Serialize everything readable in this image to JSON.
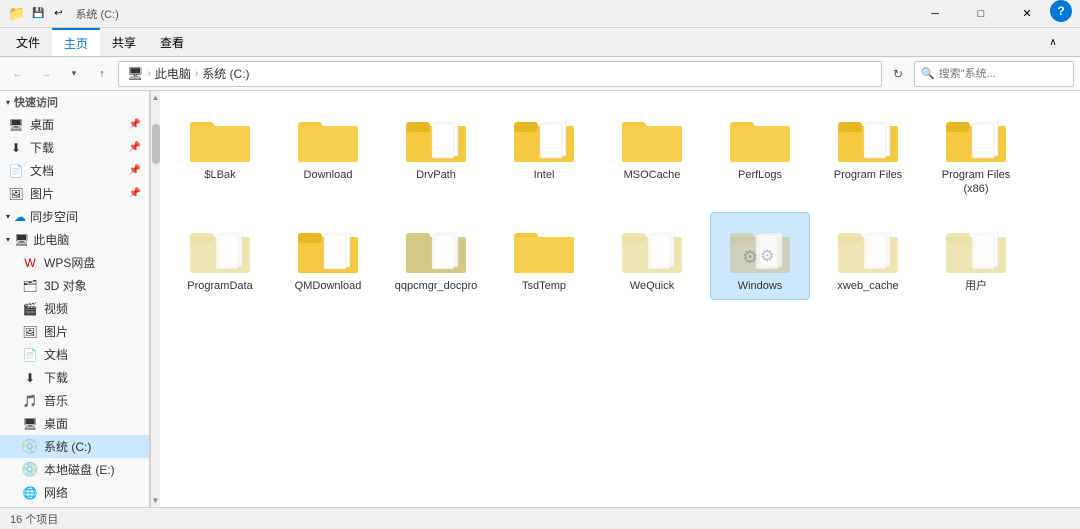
{
  "titlebar": {
    "title": "系统 (C:)",
    "minimize": "─",
    "maximize": "□",
    "close": "✕",
    "help": "?"
  },
  "ribbon": {
    "tabs": [
      "文件",
      "主页",
      "共享",
      "查看"
    ]
  },
  "addressbar": {
    "back": "←",
    "forward": "→",
    "up": "↑",
    "path_icon": "💻",
    "breadcrumb": [
      "此电脑",
      "系统 (C:)"
    ],
    "refresh": "↻",
    "search_placeholder": "搜索\"系统...",
    "search_icon": "🔍"
  },
  "sidebar": {
    "quick_access_label": "快速访问",
    "items_quick": [
      {
        "label": "桌面",
        "icon": "desktop",
        "pinned": true
      },
      {
        "label": "下载",
        "icon": "download",
        "pinned": true
      },
      {
        "label": "文档",
        "icon": "document",
        "pinned": true
      },
      {
        "label": "图片",
        "icon": "picture",
        "pinned": true
      }
    ],
    "onedrive_label": "同步空间",
    "this_pc_label": "此电脑",
    "items_pc": [
      {
        "label": "WPS网盘",
        "icon": "wps"
      },
      {
        "label": "3D 对象",
        "icon": "3d"
      },
      {
        "label": "视频",
        "icon": "video"
      },
      {
        "label": "图片",
        "icon": "pic"
      },
      {
        "label": "文档",
        "icon": "doc"
      },
      {
        "label": "下载",
        "icon": "dl"
      },
      {
        "label": "音乐",
        "icon": "music"
      },
      {
        "label": "桌面",
        "icon": "desk"
      }
    ],
    "drives": [
      {
        "label": "系统 (C:)",
        "icon": "drive",
        "active": true
      },
      {
        "label": "本地磁盘 (E:)",
        "icon": "drive"
      },
      {
        "label": "网络",
        "icon": "network"
      }
    ]
  },
  "folders": [
    {
      "name": "$LBak",
      "type": "normal"
    },
    {
      "name": "Download",
      "type": "normal"
    },
    {
      "name": "DrvPath",
      "type": "docs"
    },
    {
      "name": "Intel",
      "type": "docs"
    },
    {
      "name": "MSOCache",
      "type": "normal"
    },
    {
      "name": "PerfLogs",
      "type": "normal"
    },
    {
      "name": "Program Files",
      "type": "docs"
    },
    {
      "name": "Program Files (x86)",
      "type": "docs"
    },
    {
      "name": "ProgramData",
      "type": "gray-docs"
    },
    {
      "name": "QMDownload",
      "type": "docs"
    },
    {
      "name": "qqpcmgr_docpro",
      "type": "gray"
    },
    {
      "name": "TsdTemp",
      "type": "normal"
    },
    {
      "name": "WeQuick",
      "type": "gray-docs"
    },
    {
      "name": "Windows",
      "type": "win",
      "selected": true
    },
    {
      "name": "xweb_cache",
      "type": "gray-docs"
    },
    {
      "name": "用户",
      "type": "gray-docs"
    }
  ],
  "statusbar": {
    "items_count": "16 个项目"
  }
}
